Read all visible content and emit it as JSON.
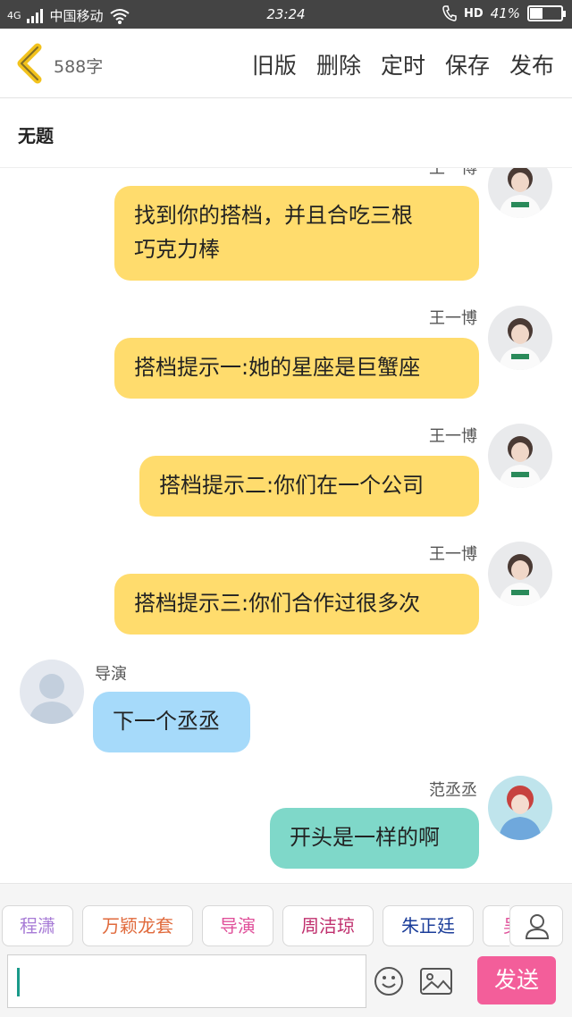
{
  "status_bar": {
    "network": "4G",
    "carrier": "中国移动",
    "time": "23:24",
    "hd": "HD",
    "battery": "41%",
    "battery_level": 0.41
  },
  "toolbar": {
    "word_count": "588字",
    "actions": [
      "旧版",
      "删除",
      "定时",
      "保存",
      "发布"
    ]
  },
  "title": "无题",
  "messages": [
    {
      "name": "王一博",
      "text_lines": [
        "找到你的搭档，并且合吃三根",
        "巧克力棒"
      ]
    },
    {
      "name": "王一博",
      "text_lines": [
        "搭档提示一:她的星座是巨蟹座"
      ]
    },
    {
      "name": "王一博",
      "text_lines": [
        "搭档提示二:你们在一个公司"
      ]
    },
    {
      "name": "王一博",
      "text_lines": [
        "搭档提示三:你们合作过很多次"
      ]
    },
    {
      "name": "导演",
      "text_lines": [
        "下一个丞丞"
      ]
    },
    {
      "name": "范丞丞",
      "text_lines": [
        "开头是一样的啊"
      ]
    }
  ],
  "role_chips": [
    {
      "label": "程潇",
      "color": "#a77bd6"
    },
    {
      "label": "万颖龙套",
      "color": "#e06a3c"
    },
    {
      "label": "导演",
      "color": "#e0509a"
    },
    {
      "label": "周洁琼",
      "color": "#c0306e"
    },
    {
      "label": "朱正廷",
      "color": "#1c3e9a"
    },
    {
      "label": "吴",
      "color": "#e0509a"
    }
  ],
  "send_label": "发送",
  "colors": {
    "bubble_self": "#ffdc6d",
    "bubble_director": "#a6dafa",
    "bubble_fan": "#7fd8c9",
    "send": "#f35e9a",
    "back_arrow": "#f2c21c"
  }
}
